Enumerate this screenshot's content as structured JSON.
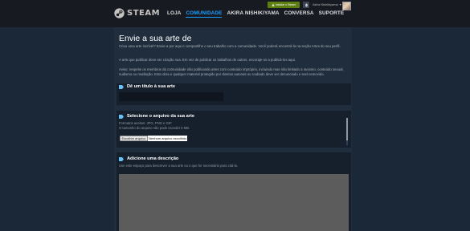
{
  "header": {
    "logo_text": "STEAM",
    "nav": [
      "LOJA",
      "COMUNIDADE",
      "AKIRA NISHIKIYAMA",
      "CONVERSA",
      "SUPORTE"
    ],
    "active_nav_index": 1,
    "install_label": "Instalar o Steam",
    "account_name": "Akira Nishikiyama"
  },
  "page": {
    "title": "Envie a sua arte de",
    "intro": "Criou uma arte incrível? Envie-a por aqui e compartilhe o seu trabalho com a comunidade. Você poderá encontrá-la na seção Artes do seu perfil.",
    "rule": "A arte que publicar deve ser criação sua. Em vez de publicar os trabalhos de outros, encoraje-os a publicá-los aqui.",
    "warning": "Aviso: respeite os membros da comunidade não publicando artes com conteúdo impróprio, incluindo mas não limitado a racismo, conteúdo sexual, nudismo ou mutilação. Esta obra e qualquer material protegido por direitos autorais ou roubado deve ser denunciado e será removido."
  },
  "sections": {
    "title_section": {
      "heading": "Dê um título à sua arte",
      "value": ""
    },
    "file_section": {
      "heading": "Selecione o arquivo da sua arte",
      "formats": "Formatos aceitos: JPG, PNG e GIF.",
      "size_limit": "O tamanho do arquivo não pode exceder 5 MB.",
      "choose_label": "Escolher arquivo",
      "status": "Nenhum arquivo escolhido"
    },
    "description_section": {
      "heading": "Adicione uma descrição",
      "hint": "Use este espaço para descrever a sua arte ou o que for necessário para citá-la."
    }
  },
  "colors": {
    "page_bg": "#1b2838",
    "header_bg": "#171a21",
    "accent": "#1a9fff",
    "install_green": "#5c7e10"
  }
}
